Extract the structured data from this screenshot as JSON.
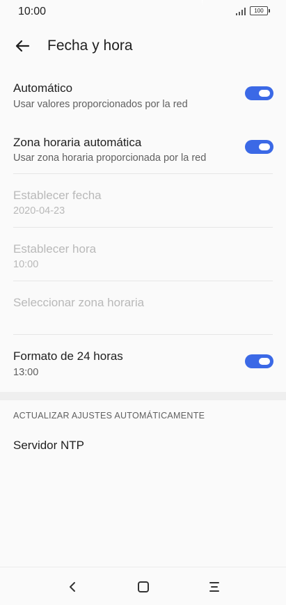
{
  "status_bar": {
    "time": "10:00",
    "battery": "100",
    "icons": [
      "signal-icon",
      "battery-icon"
    ]
  },
  "header": {
    "back_icon": "arrow-left-icon",
    "title": "Fecha y hora"
  },
  "settings": {
    "automatico": {
      "title": "Automático",
      "subtitle": "Usar valores proporcionados por la red",
      "enabled": true
    },
    "zona_automatica": {
      "title": "Zona horaria automática",
      "subtitle": "Usar zona horaria proporcionada por la red",
      "enabled": true
    },
    "establecer_fecha": {
      "title": "Establecer fecha",
      "value": "2020-04-23"
    },
    "establecer_hora": {
      "title": "Establecer hora",
      "value": "10:00"
    },
    "seleccionar_zona": {
      "title": "Seleccionar zona horaria"
    },
    "formato_24": {
      "title": "Formato de 24 horas",
      "value": "13:00",
      "enabled": true
    }
  },
  "section": {
    "header": "ACTUALIZAR AJUSTES AUTOMÁTICAMENTE",
    "ntp_label": "Servidor NTP"
  },
  "navbar": {
    "icons": [
      "back-chevron-icon",
      "home-square-icon",
      "menu-icon"
    ]
  },
  "colors": {
    "accent": "#3b69e6",
    "background": "#fafafa",
    "disabled_text": "#b9b9b9",
    "secondary_text": "#606060"
  }
}
